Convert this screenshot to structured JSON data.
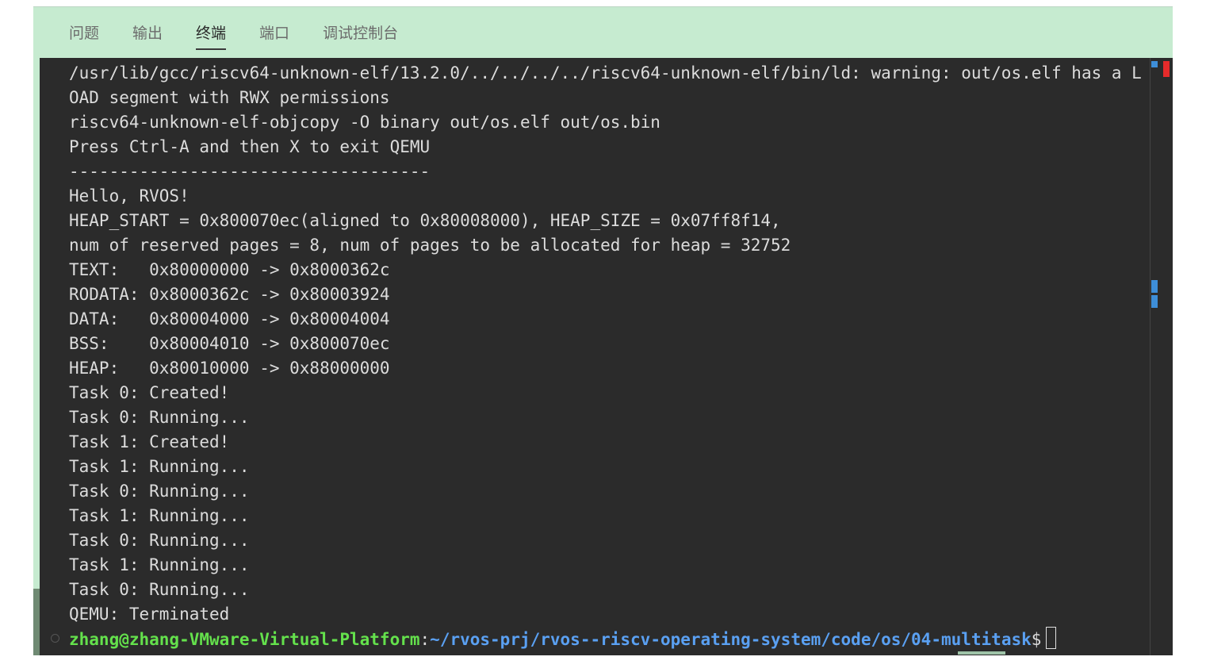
{
  "panel": {
    "tabs": [
      {
        "label": "问题",
        "active": false
      },
      {
        "label": "输出",
        "active": false
      },
      {
        "label": "终端",
        "active": true
      },
      {
        "label": "端口",
        "active": false
      },
      {
        "label": "调试控制台",
        "active": false
      }
    ]
  },
  "terminal": {
    "lines": [
      "/usr/lib/gcc/riscv64-unknown-elf/13.2.0/../../../../riscv64-unknown-elf/bin/ld: warning: out/os.elf has a L",
      "OAD segment with RWX permissions",
      "riscv64-unknown-elf-objcopy -O binary out/os.elf out/os.bin",
      "Press Ctrl-A and then X to exit QEMU",
      "------------------------------------",
      "Hello, RVOS!",
      "HEAP_START = 0x800070ec(aligned to 0x80008000), HEAP_SIZE = 0x07ff8f14,",
      "num of reserved pages = 8, num of pages to be allocated for heap = 32752",
      "TEXT:   0x80000000 -> 0x8000362c",
      "RODATA: 0x8000362c -> 0x80003924",
      "DATA:   0x80004000 -> 0x80004004",
      "BSS:    0x80004010 -> 0x800070ec",
      "HEAP:   0x80010000 -> 0x88000000",
      "Task 0: Created!",
      "Task 0: Running...",
      "Task 1: Created!",
      "Task 1: Running...",
      "Task 0: Running...",
      "Task 1: Running...",
      "Task 0: Running...",
      "Task 1: Running...",
      "Task 0: Running...",
      "QEMU: Terminated"
    ],
    "prompt": {
      "user_host": "zhang@zhang-VMware-Virtual-Platform",
      "colon": ":",
      "path": "~/rvos-prj/rvos--riscv-operating-system/code/os/04-multitask",
      "dollar": "$"
    }
  },
  "colors": {
    "tab_bar_bg": "#c6ebd0",
    "terminal_bg": "#2b2b2b",
    "terminal_fg": "#dcdcdc",
    "prompt_user": "#64e14c",
    "prompt_path": "#5aa0f2",
    "error_marker": "#e62b2b",
    "info_marker": "#3e8ed8"
  }
}
